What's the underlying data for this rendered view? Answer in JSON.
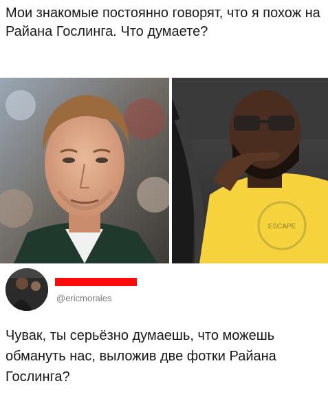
{
  "post": {
    "caption": "Мои знакомые постоянно говорят, что я похож на Райана Гослинга. Что думаете?"
  },
  "photos": {
    "left_alt": "portrait-photo-man-blond-hair",
    "right_alt": "selfie-photo-man-glasses-beard-yellow-shirt",
    "shirt_print": "ESCAPE"
  },
  "tweet": {
    "handle": "@ericmorales",
    "name_redacted_color": "#ff0a0a",
    "text": "Чувак, ты серьёзно думаешь, что можешь обмануть нас, выложив две фотки Райана Гослинга?"
  }
}
